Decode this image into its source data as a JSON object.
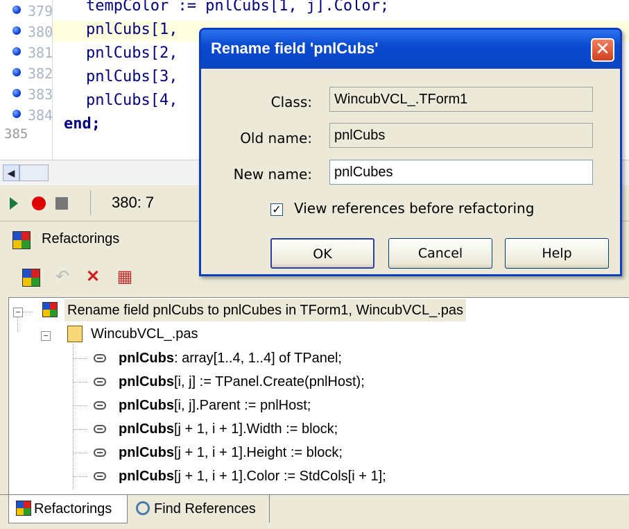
{
  "editor": {
    "gutter": [
      "379",
      "380",
      "381",
      "382",
      "383",
      "384",
      "385"
    ],
    "lines": [
      {
        "prefix": "  ",
        "text": "tempColor := pnlCubs[1, j].Color;"
      },
      {
        "prefix": "  ",
        "text": "pnlCubs[1,"
      },
      {
        "prefix": "  ",
        "text": "pnlCubs[2,"
      },
      {
        "prefix": "  ",
        "text": "pnlCubs[3,"
      },
      {
        "prefix": "  ",
        "text": "pnlCubs[4,"
      },
      {
        "prefix": "",
        "text": "end;"
      }
    ]
  },
  "status": {
    "position": "380:  7"
  },
  "panel": {
    "title": "Refactorings",
    "tree": {
      "root": "Rename field pnlCubs to pnlCubes in TForm1, WincubVCL_.pas",
      "file": "WincubVCL_.pas",
      "items": [
        {
          "ident": "pnlCubs",
          "rest": ": array[1..4, 1..4] of TPanel;"
        },
        {
          "ident": "pnlCubs",
          "rest": "[i, j] := TPanel.Create(pnlHost);"
        },
        {
          "ident": "pnlCubs",
          "rest": "[i, j].Parent := pnlHost;"
        },
        {
          "ident": "pnlCubs",
          "rest": "[j + 1, i + 1].Width := block;"
        },
        {
          "ident": "pnlCubs",
          "rest": "[j + 1, i + 1].Height := block;"
        },
        {
          "ident": "pnlCubs",
          "rest": "[j + 1, i + 1].Color := StdCols[i + 1];"
        }
      ]
    },
    "tabs": [
      "Refactorings",
      "Find References"
    ]
  },
  "dialog": {
    "title": "Rename field 'pnlCubs'",
    "class_label": "Class:",
    "class_value": "WincubVCL_.TForm1",
    "old_label": "Old name:",
    "old_value": "pnlCubs",
    "new_label": "New name:",
    "new_value": "pnlCubes",
    "checkbox_label": "View references before refactoring",
    "checkbox_checked": true,
    "ok": "OK",
    "cancel": "Cancel",
    "help": "Help"
  }
}
